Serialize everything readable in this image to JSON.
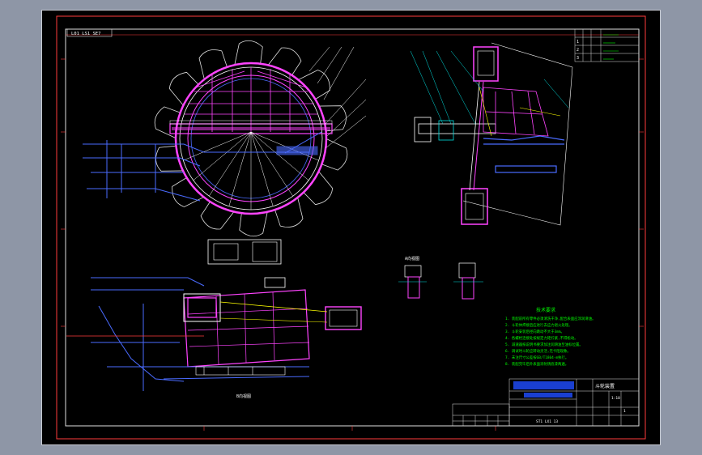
{
  "drawing": {
    "sheet_code": "L01 LS1 SE7",
    "sheet_code_bottom": "ST1 LX1 13",
    "view_label": "A向视图",
    "view_label_lower": "B向视图",
    "notes_title": "技术要求",
    "notes": [
      "1. 装配前所有零件必须清洗干净,配合表面应涂润滑油。",
      "2. 斗轮体焊接后应进行去应力退火处理。",
      "3. 斗轮安装后径向跳动不大于3mm。",
      "4. 各螺栓连接处按规定力矩拧紧,不得松动。",
      "5. 减速器按说明书要求加注润滑油至油标位置。",
      "6. 调试时斗轮应转动灵活,无卡阻现象。",
      "7. 未注尺寸公差按GB/T1804-m执行。",
      "8. 装配完毕后外表面涂防锈底漆两遍。"
    ],
    "parts_table_rows": [
      "1",
      "2",
      "3"
    ],
    "title_block": {
      "name": "斗轮装置",
      "scale": "1:10",
      "sheet": "1"
    }
  }
}
